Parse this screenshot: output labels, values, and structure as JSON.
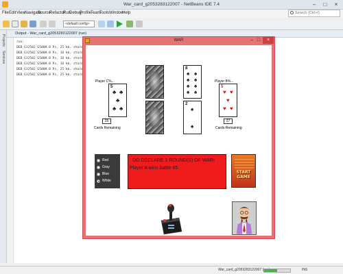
{
  "ide": {
    "title": "War_card_g2053283122007 - NetBeans IDE 7.4",
    "menu": [
      "File",
      "Edit",
      "View",
      "Navigate",
      "Source",
      "Refactor",
      "Run",
      "Debug",
      "Profile",
      "Team",
      "Tools",
      "Window",
      "Help"
    ],
    "search_placeholder": "Search (Ctrl+I)",
    "config_select": "<default config>",
    "left_strip_labels": [
      "Projects",
      "Services"
    ],
    "output_tab": "Output - War_card_g2053283122007 (run)",
    "output_lines": [
      "run:",
      "DEB_G12582 G5000.0 Ps, 25 kb, shared...",
      "DEB_G12582 G5000.0 Ps, 16 kb, stored...",
      "DEB_G12582 G5000.0 Ps, 16 kb, stored...",
      "DEB_G12582 G5000.0 Ps, 16 kb, stored...",
      "DEB_G12582 G5000.0 Ps, 25 kb, shared...",
      "DEB_G12582 G5000.0 Ps, 25 kb, stored..."
    ],
    "status": {
      "text": "War_card_g2053283122007 (run)",
      "progress": 0.5,
      "ins": "INS"
    }
  },
  "war": {
    "title": "WAR",
    "player_a": {
      "name": "Player C%...",
      "card_rank": "5",
      "card_suit": "♣",
      "count": "25",
      "remaining_label": "Cards Remaining"
    },
    "player_b": {
      "name": "Player B%...",
      "card_rank": "5",
      "card_suit": "♥",
      "count": "27",
      "remaining_label": "Cards Remaining"
    },
    "center_top": {
      "rank": "8",
      "suit": "♠"
    },
    "center_bottom": {
      "rank": "2",
      "suit": "♠"
    },
    "colors": {
      "options": [
        "Red",
        "Gray",
        "Blue",
        "White"
      ],
      "selected": "White"
    },
    "message_lines": [
      "DO DECLARE 1 ROUND(S) OF WAR!",
      "Player A wins battle #5"
    ],
    "start_button_lines": [
      "START",
      "GAME"
    ],
    "palette": {
      "window_border": "#e57373",
      "message_bg": "#ee1c1c",
      "panel_bg": "#3a3a3a"
    }
  }
}
